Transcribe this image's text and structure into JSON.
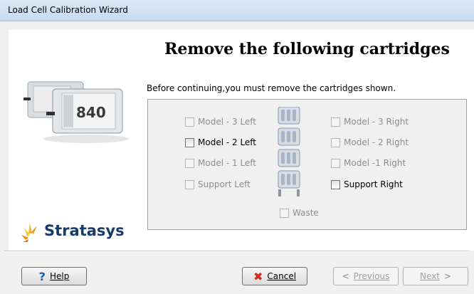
{
  "window": {
    "title": "Load Cell Calibration Wizard"
  },
  "brand": {
    "logo_text": "Stratasys",
    "cartridge_label": "840"
  },
  "main": {
    "heading": "Remove the following cartridges",
    "instruction": "Before continuing,you must remove the cartridges shown."
  },
  "cartridges": {
    "left": [
      {
        "label": "Model - 3 Left",
        "enabled": false,
        "checked": false
      },
      {
        "label": "Model - 2 Left",
        "enabled": true,
        "checked": false
      },
      {
        "label": "Model - 1 Left",
        "enabled": false,
        "checked": false
      },
      {
        "label": "Support Left",
        "enabled": false,
        "checked": false
      }
    ],
    "right": [
      {
        "label": "Model - 3 Right",
        "enabled": false,
        "checked": false
      },
      {
        "label": "Model - 2 Right",
        "enabled": false,
        "checked": false
      },
      {
        "label": "Model -1 Right",
        "enabled": false,
        "checked": false
      },
      {
        "label": "Support Right",
        "enabled": true,
        "checked": false
      }
    ],
    "waste": {
      "label": "Waste",
      "enabled": false,
      "checked": false
    }
  },
  "buttons": {
    "help": {
      "label": "Help",
      "icon": "question-icon"
    },
    "cancel": {
      "label": "Cancel",
      "icon": "red-x-icon"
    },
    "previous": {
      "label": "Previous",
      "icon": "arrow-left-icon",
      "enabled": false
    },
    "next": {
      "label": "Next",
      "icon": "arrow-right-icon",
      "enabled": false
    }
  },
  "colors": {
    "title_bar": "#c6dbf2",
    "logo": "#163b6a",
    "help_icon": "#1a5fb4",
    "cancel_icon": "#d12a1c"
  }
}
